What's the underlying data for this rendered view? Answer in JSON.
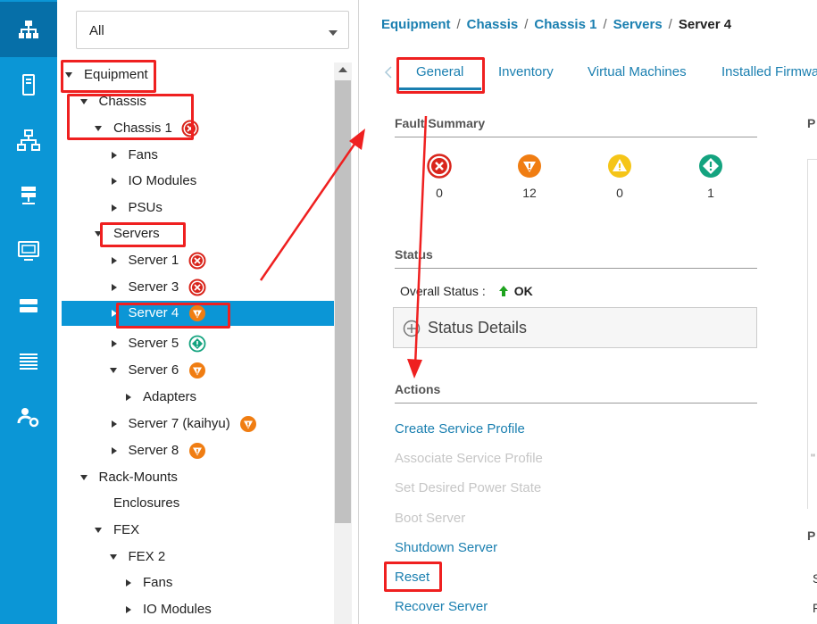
{
  "rail": {
    "items": [
      {
        "icon": "network-tree-icon",
        "active": true
      },
      {
        "icon": "server-icon",
        "active": false
      },
      {
        "icon": "lan-icon",
        "active": false
      },
      {
        "icon": "san-icon",
        "active": false
      },
      {
        "icon": "vm-monitor-icon",
        "active": false
      },
      {
        "icon": "storage-icon",
        "active": false
      },
      {
        "icon": "list-icon",
        "active": false
      },
      {
        "icon": "admin-gear-icon",
        "active": false
      }
    ]
  },
  "tree": {
    "filter_value": "All",
    "nodes": [
      {
        "label": "Equipment",
        "level": 0,
        "toggle": "expanded",
        "status": null
      },
      {
        "label": "Chassis",
        "level": 1,
        "toggle": "expanded",
        "status": null
      },
      {
        "label": "Chassis 1",
        "level": 2,
        "toggle": "expanded",
        "status": "critical"
      },
      {
        "label": "Fans",
        "level": 3,
        "toggle": "collapsed",
        "status": null
      },
      {
        "label": "IO Modules",
        "level": 3,
        "toggle": "collapsed",
        "status": null
      },
      {
        "label": "PSUs",
        "level": 3,
        "toggle": "collapsed",
        "status": null
      },
      {
        "label": "Servers",
        "level": 2,
        "toggle": "expanded",
        "status": null
      },
      {
        "label": "Server 1",
        "level": 3,
        "toggle": "collapsed",
        "status": "critical"
      },
      {
        "label": "Server 3",
        "level": 3,
        "toggle": "collapsed",
        "status": "critical"
      },
      {
        "label": "Server 4",
        "level": 3,
        "toggle": "collapsed",
        "status": "major",
        "selected": true
      },
      {
        "label": "Server 5",
        "level": 3,
        "toggle": "collapsed",
        "status": "warning"
      },
      {
        "label": "Server 6",
        "level": 3,
        "toggle": "expanded",
        "status": "major"
      },
      {
        "label": "Adapters",
        "level": 4,
        "toggle": "collapsed",
        "status": null
      },
      {
        "label": "Server 7 (kaihyu)",
        "level": 3,
        "toggle": "collapsed",
        "status": "major"
      },
      {
        "label": "Server 8",
        "level": 3,
        "toggle": "collapsed",
        "status": "major"
      },
      {
        "label": "Rack-Mounts",
        "level": 1,
        "toggle": "expanded",
        "status": null
      },
      {
        "label": "Enclosures",
        "level": 2,
        "toggle": "none",
        "status": null
      },
      {
        "label": "FEX",
        "level": 2,
        "toggle": "expanded",
        "status": null
      },
      {
        "label": "FEX 2",
        "level": 3,
        "toggle": "expanded",
        "status": null
      },
      {
        "label": "Fans",
        "level": 4,
        "toggle": "collapsed",
        "status": null
      },
      {
        "label": "IO Modules",
        "level": 4,
        "toggle": "collapsed",
        "status": null
      }
    ]
  },
  "breadcrumb": {
    "links": [
      "Equipment",
      "Chassis",
      "Chassis 1",
      "Servers"
    ],
    "current": "Server 4",
    "separator": "/"
  },
  "tabs": [
    "General",
    "Inventory",
    "Virtual Machines",
    "Installed Firmwa"
  ],
  "fault_summary": {
    "title": "Fault Summary",
    "items": [
      {
        "icon": "critical-fault-icon",
        "count": "0",
        "color": "#d9251c"
      },
      {
        "icon": "major-fault-icon",
        "count": "12",
        "color": "#f07d12"
      },
      {
        "icon": "minor-fault-icon",
        "count": "0",
        "color": "#f5c518"
      },
      {
        "icon": "warning-fault-icon",
        "count": "1",
        "color": "#14a37f"
      }
    ]
  },
  "status": {
    "title": "Status",
    "overall_label": "Overall Status :",
    "overall_value": "OK",
    "details_label": "Status Details"
  },
  "actions": {
    "title": "Actions",
    "items": [
      {
        "label": "Create Service Profile",
        "enabled": true
      },
      {
        "label": "Associate Service Profile",
        "enabled": false
      },
      {
        "label": "Set Desired Power State",
        "enabled": false
      },
      {
        "label": "Boot Server",
        "enabled": false
      },
      {
        "label": "Shutdown Server",
        "enabled": true
      },
      {
        "label": "Reset",
        "enabled": true
      },
      {
        "label": "Recover Server",
        "enabled": true
      }
    ]
  },
  "edge_fragments": {
    "top": "P",
    "bottom": "P",
    "s": "S",
    "r": "F",
    "quote": "\""
  },
  "colors": {
    "rail": "#0b96d6",
    "selected": "#0b96d6",
    "link": "#1a7fb0",
    "highlight": "#ef2020",
    "ok_arrow": "#1fa31f"
  }
}
